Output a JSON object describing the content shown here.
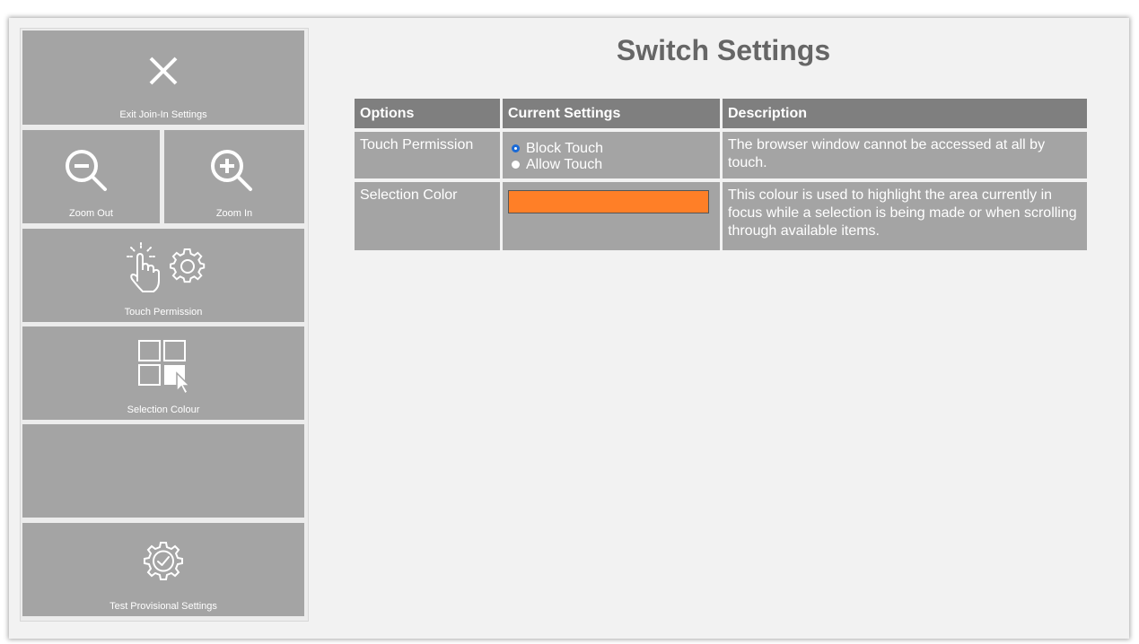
{
  "sidebar": {
    "exit_label": "Exit Join-In Settings",
    "zoom_out_label": "Zoom Out",
    "zoom_in_label": "Zoom In",
    "touch_permission_label": "Touch Permission",
    "selection_colour_label": "Selection Colour",
    "test_label": "Test Provisional Settings"
  },
  "page": {
    "title": "Switch Settings"
  },
  "table": {
    "headers": [
      "Options",
      "Current Settings",
      "Description"
    ],
    "rows": [
      {
        "option": "Touch Permission",
        "radios": [
          "Block Touch",
          "Allow Touch"
        ],
        "selected": "Block Touch",
        "description": "The browser window cannot be accessed at all by touch."
      },
      {
        "option": "Selection Color",
        "color": "#ff7f27",
        "description": "This colour is used to highlight the area currently in focus while a selection is being made or when scrolling through available items."
      }
    ]
  },
  "colors": {
    "tile": "#a4a4a4",
    "header": "#7f7f7f",
    "radio_accent": "#1a6ad6",
    "selection_color": "#ff7f27"
  }
}
